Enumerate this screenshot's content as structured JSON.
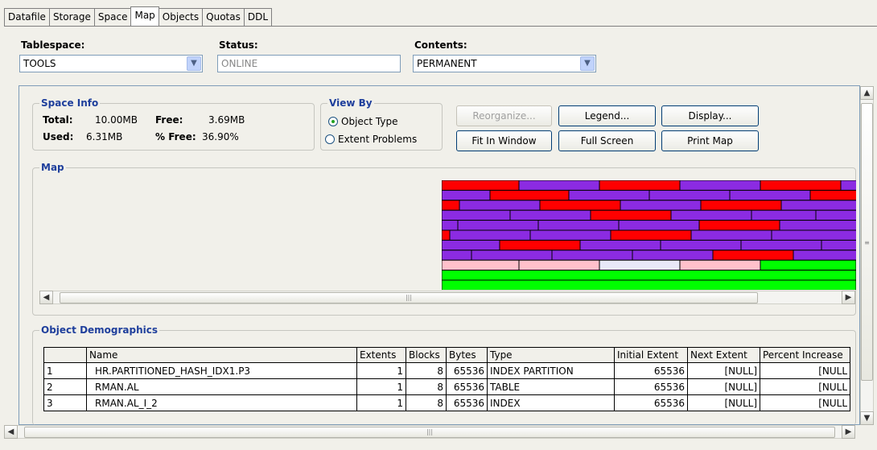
{
  "tabs": [
    "Datafile",
    "Storage",
    "Space",
    "Map",
    "Objects",
    "Quotas",
    "DDL"
  ],
  "active_tab": "Map",
  "tablespace": {
    "label": "Tablespace:",
    "value": "TOOLS"
  },
  "status": {
    "label": "Status:",
    "value": "ONLINE"
  },
  "contents": {
    "label": "Contents:",
    "value": "PERMANENT"
  },
  "space_info": {
    "title": "Space Info",
    "total_label": "Total:",
    "total_value": "10.00MB",
    "free_label": "Free:",
    "free_value": "3.69MB",
    "used_label": "Used:",
    "used_value": "6.31MB",
    "pct_free_label": "% Free:",
    "pct_free_value": "36.90%"
  },
  "view_by": {
    "title": "View By",
    "options": [
      "Object Type",
      "Extent Problems"
    ],
    "selected": "Object Type"
  },
  "buttons": {
    "reorganize": "Reorganize...",
    "legend": "Legend...",
    "display": "Display...",
    "fit_in_window": "Fit In Window",
    "full_screen": "Full Screen",
    "print_map": "Print Map"
  },
  "map": {
    "title": "Map",
    "colors": {
      "table": "#ff0000",
      "index": "#8b2be2",
      "partition": "#ffc0cb",
      "free": "#00ff00",
      "other": "#e8e8f8"
    }
  },
  "demographics": {
    "title": "Object Demographics",
    "columns": [
      "",
      "Name",
      "Extents",
      "Blocks",
      "Bytes",
      "Type",
      "Initial Extent",
      "Next Extent",
      "Percent Increase"
    ],
    "rows": [
      [
        "1",
        "HR.PARTITIONED_HASH_IDX1.P3",
        "1",
        "8",
        "65536",
        "INDEX PARTITION",
        "65536",
        "[NULL]",
        "[NULL"
      ],
      [
        "2",
        "RMAN.AL",
        "1",
        "8",
        "65536",
        "TABLE",
        "65536",
        "[NULL]",
        "[NULL"
      ],
      [
        "3",
        "RMAN.AL_I_2",
        "1",
        "8",
        "65536",
        "INDEX",
        "65536",
        "[NULL]",
        "[NULL"
      ]
    ]
  }
}
